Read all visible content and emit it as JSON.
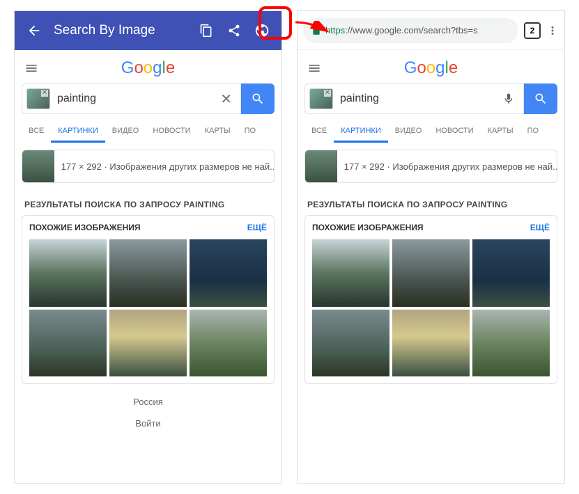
{
  "app_bar": {
    "title": "Search By Image"
  },
  "chrome": {
    "tab_count": "2",
    "url_https": "https",
    "url_rest": "://www.google.com/search?tbs=s"
  },
  "logo": [
    "G",
    "o",
    "o",
    "g",
    "l",
    "e"
  ],
  "search": {
    "query": "painting"
  },
  "tabs": {
    "all": "ВСЕ",
    "images": "КАРТИНКИ",
    "video": "ВИДЕО",
    "news": "НОВОСТИ",
    "maps": "КАРТЫ",
    "more": "ПО"
  },
  "size_info": "177 × 292 · Изображения других размеров не най...",
  "results_title": "РЕЗУЛЬТАТЫ ПОИСКА ПО ЗАПРОСУ PAINTING",
  "similar": {
    "title": "ПОХОЖИЕ ИЗОБРАЖЕНИЯ",
    "more": "ЕЩЁ"
  },
  "footer": {
    "country": "Россия",
    "login": "Войти"
  }
}
